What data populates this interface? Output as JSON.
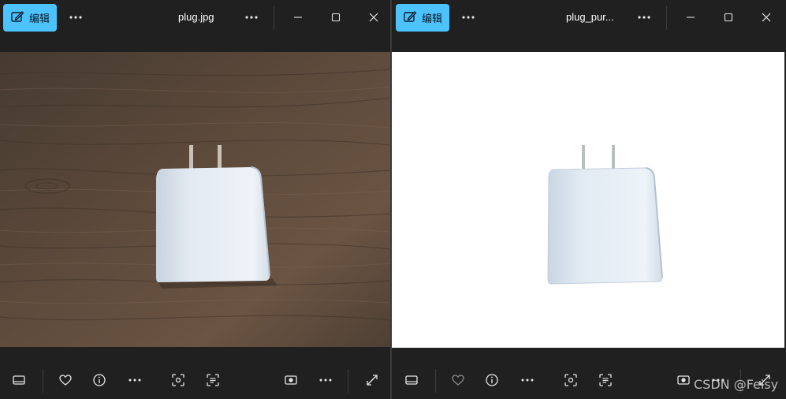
{
  "left_window": {
    "edit_label": "编辑",
    "filename": "plug.jpg"
  },
  "right_window": {
    "edit_label": "编辑",
    "filename": "plug_pur..."
  },
  "watermark": "CSDN @Feisy",
  "colors": {
    "accent": "#4cc2ff",
    "titlebar_bg": "#202020",
    "icon": "#e6e6e6",
    "wood": "#5c4a3b",
    "plug": "#dde6ef"
  },
  "icons": {
    "edit": "edit-image-icon",
    "more": "more-icon",
    "minimize": "minimize-icon",
    "maximize": "maximize-icon",
    "close": "close-icon",
    "filmstrip": "filmstrip-icon",
    "favorite": "heart-icon",
    "info": "info-icon",
    "search": "visual-search-icon",
    "text": "text-scan-icon",
    "background": "background-icon",
    "fullscreen": "expand-icon"
  }
}
